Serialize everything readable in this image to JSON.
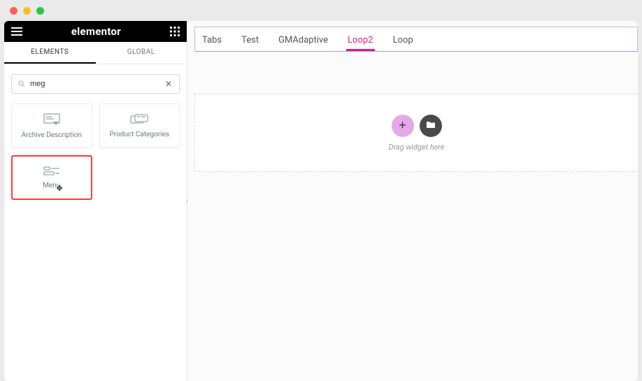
{
  "app": {
    "brand": "elementor"
  },
  "sidebar": {
    "tabs": {
      "elements": "ELEMENTS",
      "global": "GLOBAL"
    },
    "search": {
      "value": "meg"
    },
    "widgets": [
      {
        "label": "Archive Description",
        "icon": "archive-desc-icon",
        "highlighted": false
      },
      {
        "label": "Product Categories",
        "icon": "product-cat-icon",
        "highlighted": false
      },
      {
        "label": "Menu",
        "icon": "menu-widget-icon",
        "highlighted": true
      }
    ]
  },
  "canvas": {
    "tabs": [
      {
        "label": "Tabs",
        "active": false
      },
      {
        "label": "Test",
        "active": false
      },
      {
        "label": "GMAdaptive",
        "active": false
      },
      {
        "label": "Loop2",
        "active": true
      },
      {
        "label": "Loop",
        "active": false
      }
    ],
    "drop_hint": "Drag widget here"
  }
}
